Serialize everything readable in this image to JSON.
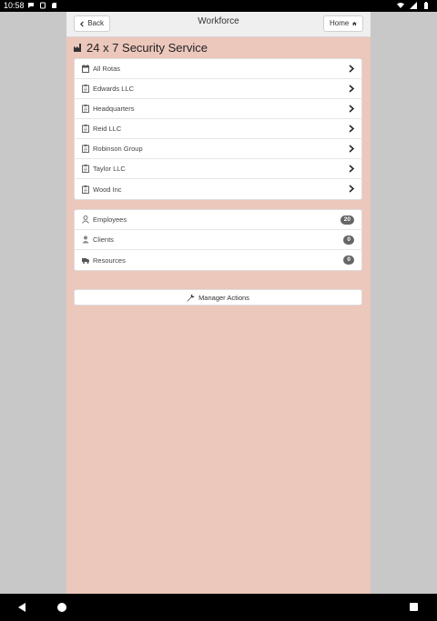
{
  "status_bar": {
    "time": "10:58",
    "left_icons": [
      "message-icon",
      "notification-icon",
      "sd-card-icon"
    ],
    "right_icons": [
      "wifi-icon",
      "signal-icon",
      "battery-icon"
    ]
  },
  "header": {
    "back_label": "Back",
    "title": "Workforce",
    "home_label": "Home"
  },
  "page": {
    "title": "24 x 7 Security Service",
    "title_icon": "factory-icon"
  },
  "rotas": [
    {
      "label": "All Rotas",
      "icon": "calendar-icon"
    },
    {
      "label": "Edwards LLC",
      "icon": "clipboard-icon"
    },
    {
      "label": "Headquarters",
      "icon": "clipboard-icon"
    },
    {
      "label": "Reid LLC",
      "icon": "clipboard-icon"
    },
    {
      "label": "Robinson Group",
      "icon": "clipboard-icon"
    },
    {
      "label": "Taylor LLC",
      "icon": "clipboard-icon"
    },
    {
      "label": "Wood Inc",
      "icon": "clipboard-icon"
    }
  ],
  "people": [
    {
      "label": "Employees",
      "icon": "user-icon",
      "count": "20"
    },
    {
      "label": "Clients",
      "icon": "client-icon",
      "count": "0"
    },
    {
      "label": "Resources",
      "icon": "truck-icon",
      "count": "0"
    }
  ],
  "manager_actions_label": "Manager Actions",
  "colors": {
    "page_background": "#ecc7bc",
    "header_background": "#efefef",
    "badge": "#666666"
  }
}
